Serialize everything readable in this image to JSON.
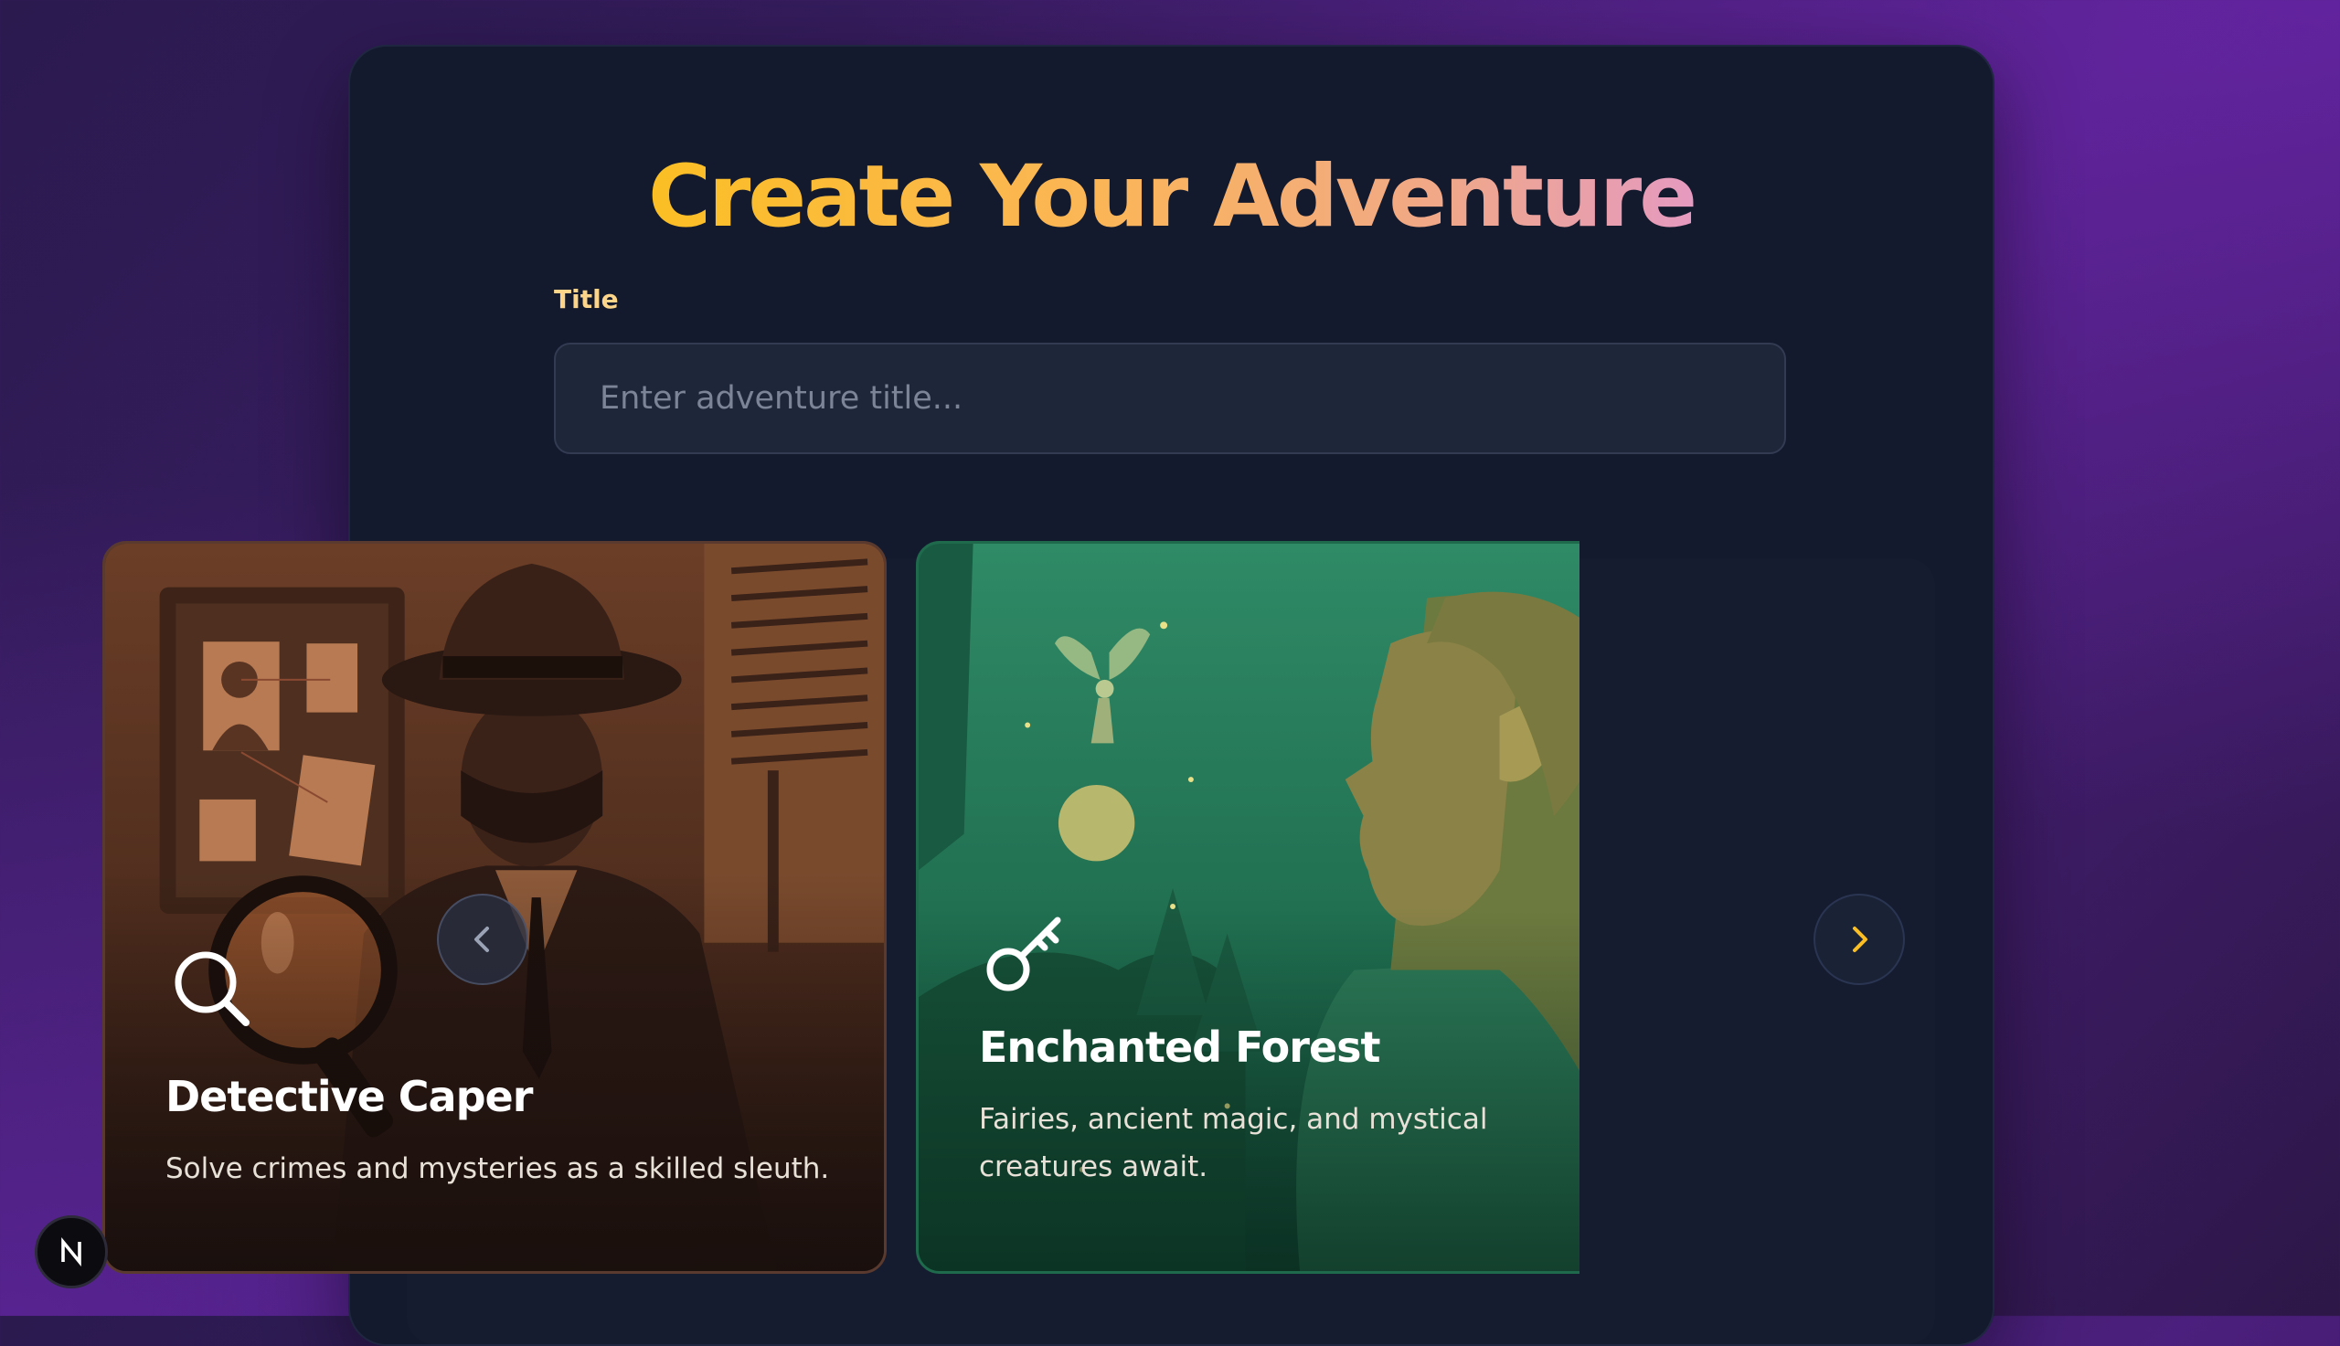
{
  "page": {
    "heading": "Create Your Adventure"
  },
  "form": {
    "title_label": "Title",
    "title_value": "",
    "title_placeholder": "Enter adventure title..."
  },
  "carousel": {
    "cards": [
      {
        "title": "Detective Caper",
        "description": "Solve crimes and mysteries as a skilled sleuth.",
        "icon": "magnifying-glass-icon"
      },
      {
        "title": "Enchanted Forest",
        "description": "Fairies, ancient magic, and mystical creatures await.",
        "icon": "key-icon"
      }
    ],
    "prev_icon": "chevron-left-icon",
    "next_icon": "chevron-right-icon"
  },
  "badge": {
    "letter": "N"
  },
  "colors": {
    "heading_gradient_start": "#fbbf24",
    "heading_gradient_end": "#e59ac0",
    "label": "#fcd58a",
    "panel": "#131a2e",
    "next_arrow": "#fbbf24"
  }
}
